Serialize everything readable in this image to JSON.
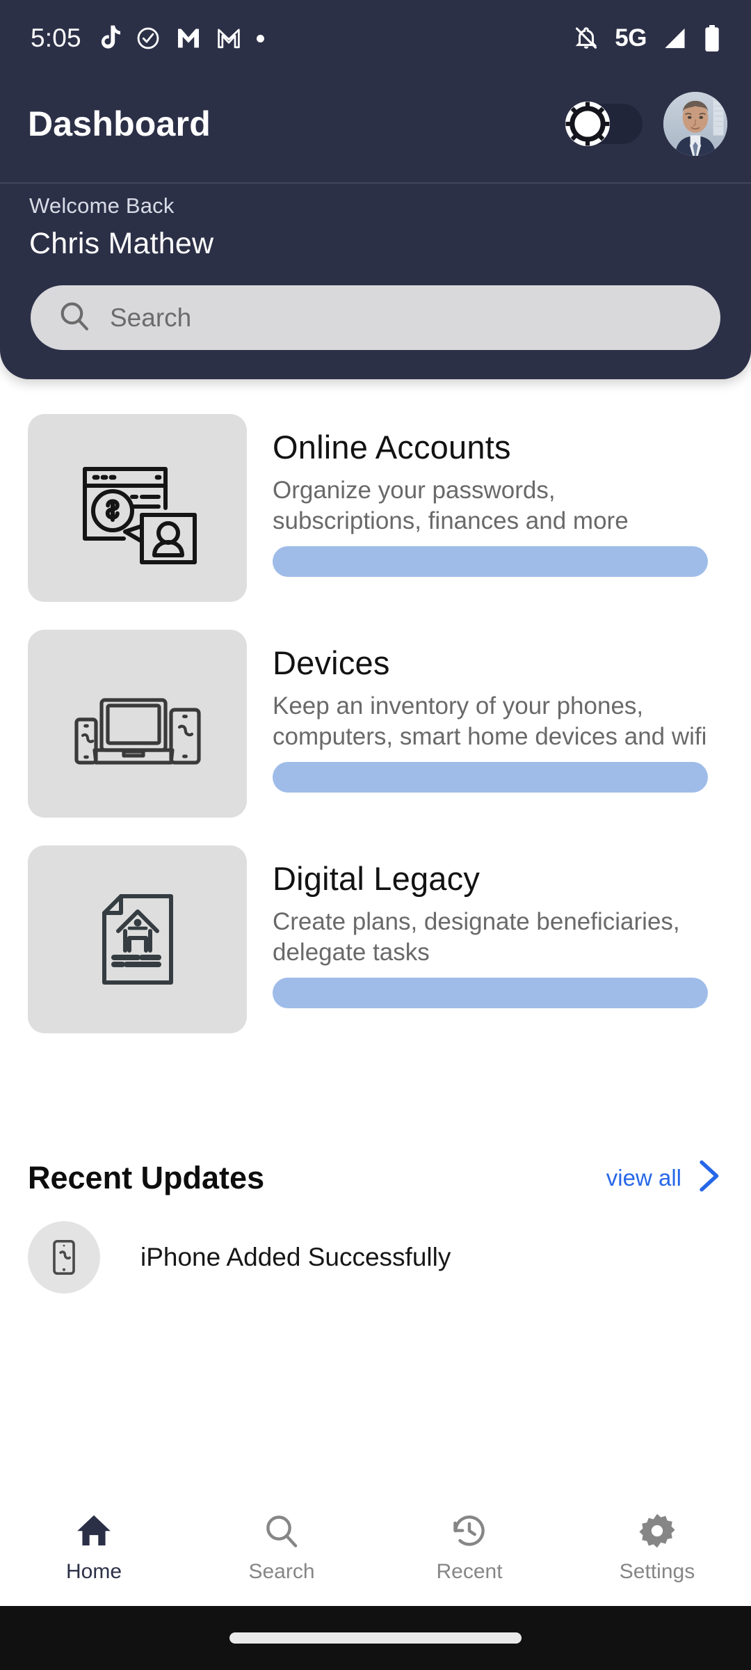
{
  "status_bar": {
    "time": "5:05",
    "left_icons": [
      "tiktok-icon",
      "check-circle-icon",
      "gmail-m-icon",
      "gmail-outline-icon",
      "dot-icon"
    ],
    "network": "5G",
    "right_icons": [
      "notifications-off-icon",
      "signal-icon",
      "battery-icon"
    ]
  },
  "header": {
    "title": "Dashboard",
    "theme_toggle": {
      "state": "off",
      "knob_icon": "sun-icon"
    },
    "avatar": "user-avatar",
    "welcome_label": "Welcome Back",
    "user_name": "Chris Mathew"
  },
  "search": {
    "placeholder": "Search",
    "value": "",
    "icon": "search-icon"
  },
  "cards": [
    {
      "title": "Online Accounts",
      "description": "Organize your passwords, subscriptions, finances and more",
      "icon": "online-accounts-icon",
      "bar_color": "#9fbce9"
    },
    {
      "title": "Devices",
      "description": "Keep an inventory of your phones, computers, smart home devices and wifi",
      "icon": "devices-icon",
      "bar_color": "#9fbce9"
    },
    {
      "title": "Digital Legacy",
      "description": "Create plans, designate beneficiaries, delegate tasks",
      "icon": "digital-legacy-icon",
      "bar_color": "#9fbce9"
    }
  ],
  "recent_updates": {
    "heading": "Recent Updates",
    "view_all_label": "view all",
    "view_all_color": "#2667e8",
    "items": [
      {
        "icon": "phone-icon",
        "text": "iPhone  Added Successfully"
      }
    ]
  },
  "bottom_nav": {
    "items": [
      {
        "label": "Home",
        "icon": "home-icon",
        "active": true
      },
      {
        "label": "Search",
        "icon": "search-icon",
        "active": false
      },
      {
        "label": "Recent",
        "icon": "history-clock-icon",
        "active": false
      },
      {
        "label": "Settings",
        "icon": "gear-icon",
        "active": false
      }
    ]
  },
  "theme": {
    "header_bg": "#2c3047",
    "page_bg": "#ffffff",
    "icon_box_bg": "#dedede",
    "accent_blue": "#9fbce9",
    "link_blue": "#2667e8",
    "gesture_bar_bg": "#111111"
  }
}
